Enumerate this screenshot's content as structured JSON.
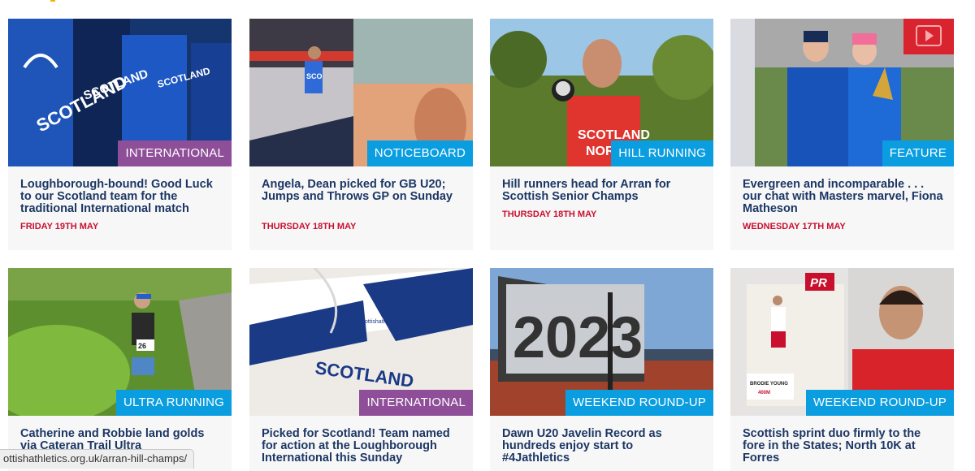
{
  "articles": [
    {
      "category": "INTERNATIONAL",
      "title": "Loughborough-bound! Good Luck to our Scotland team for the traditional International match",
      "date": "FRIDAY 19TH MAY"
    },
    {
      "category": "NOTICEBOARD",
      "title": "Angela, Dean picked for GB U20; Jumps and Throws GP on Sunday",
      "date": "THURSDAY 18TH MAY"
    },
    {
      "category": "HILL RUNNING",
      "title": "Hill runners head for Arran for Scottish Senior Champs",
      "date": "THURSDAY 18TH MAY"
    },
    {
      "category": "FEATURE",
      "title": "Evergreen and incomparable . . . our chat with Masters marvel, Fiona Matheson",
      "date": "WEDNESDAY 17TH MAY"
    },
    {
      "category": "ULTRA RUNNING",
      "title": "Catherine and Robbie land golds via Cateran Trail Ultra"
    },
    {
      "category": "INTERNATIONAL",
      "title": "Picked for Scotland! Team named for action at the Loughborough International this Sunday"
    },
    {
      "category": "WEEKEND ROUND-UP",
      "title": "Dawn U20 Javelin Record as hundreds enjoy start to #4Jathletics"
    },
    {
      "category": "WEEKEND ROUND-UP",
      "title": "Scottish sprint duo firmly to the fore in the States; North 10K at Forres"
    }
  ],
  "image_text": {
    "jersey1": "SCOTLAND",
    "jersey2": "SCOTLAND",
    "jersey3": "SCOTLAND",
    "bib": "SCO",
    "shirt": "SCOTLAND",
    "shirt_sub": "NORT",
    "bib_ultra": "26",
    "kit": "SCOTLAND",
    "kit_brand": "scottishathletics",
    "board": "2023",
    "pr_badge": "PR",
    "name_card": "BRODIE YOUNG",
    "name_card_event": "400M"
  },
  "status_url": "ottishathletics.org.uk/arran-hill-champs/",
  "colors": {
    "title": "#1c3764",
    "date": "#c8102e",
    "tag_purple": "#8e4f98",
    "tag_blue": "#0a9ee0",
    "card_bg": "#f7f7f8"
  }
}
